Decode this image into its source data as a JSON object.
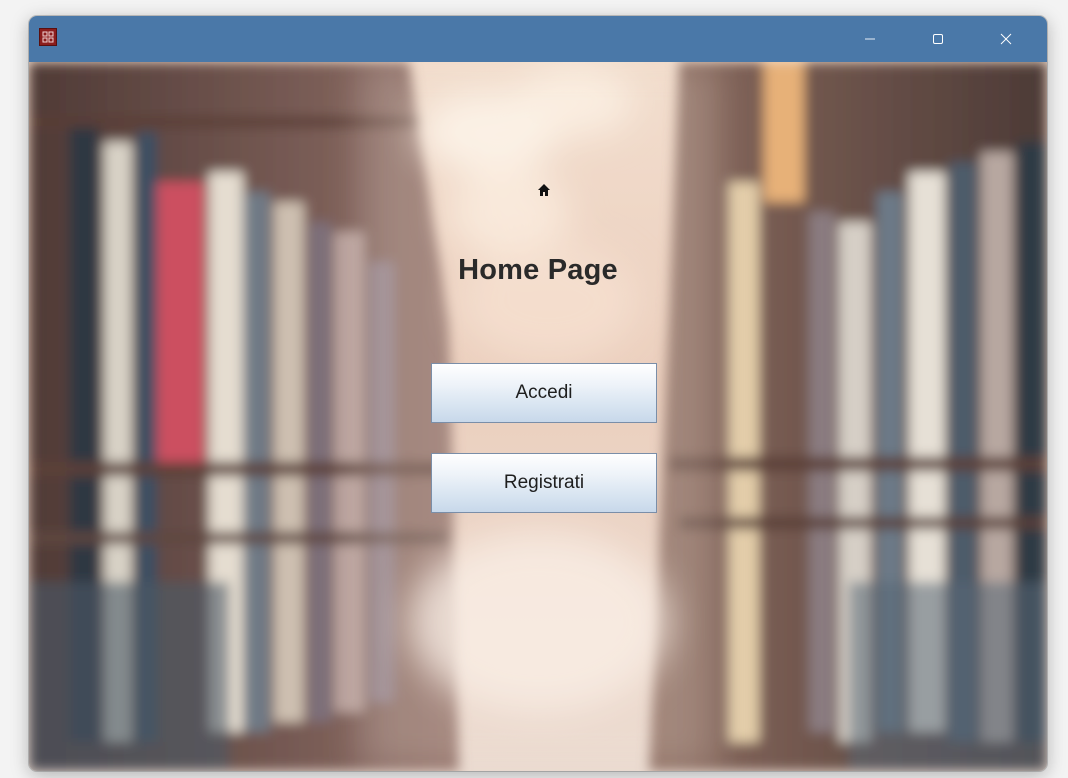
{
  "window": {
    "title": "",
    "controls": {
      "minimize": "minimize-icon",
      "maximize": "maximize-icon",
      "close": "close-icon"
    },
    "titlebar_color": "#4a78a8"
  },
  "main": {
    "icon": "home-icon",
    "title": "Home Page",
    "buttons": {
      "login_label": "Accedi",
      "register_label": "Registrati"
    }
  }
}
